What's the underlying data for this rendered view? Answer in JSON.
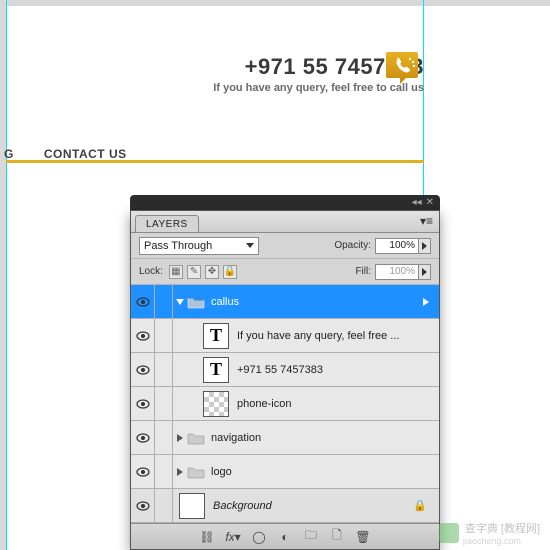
{
  "page": {
    "phone": "+971 55 7457383",
    "phone_sub": "If you have any query, feel free to call us",
    "nav_g": "G",
    "nav_contact": "CONTACT US"
  },
  "panel": {
    "title": "LAYERS",
    "blend_mode": "Pass Through",
    "opacity_label": "Opacity:",
    "opacity_value": "100%",
    "lock_label": "Lock:",
    "fill_label": "Fill:",
    "fill_value": "100%",
    "layers": {
      "callus": {
        "name": "callus"
      },
      "query_text": {
        "name": "If you have any query, feel free ..."
      },
      "phone_text": {
        "name": "+971 55 7457383"
      },
      "phone_icon": {
        "name": "phone-icon"
      },
      "navigation": {
        "name": "navigation"
      },
      "logo": {
        "name": "logo"
      },
      "background": {
        "name": "Background"
      }
    }
  },
  "watermark": {
    "text": "查字典 [教程网]",
    "sub": "jiaocheng.com"
  }
}
